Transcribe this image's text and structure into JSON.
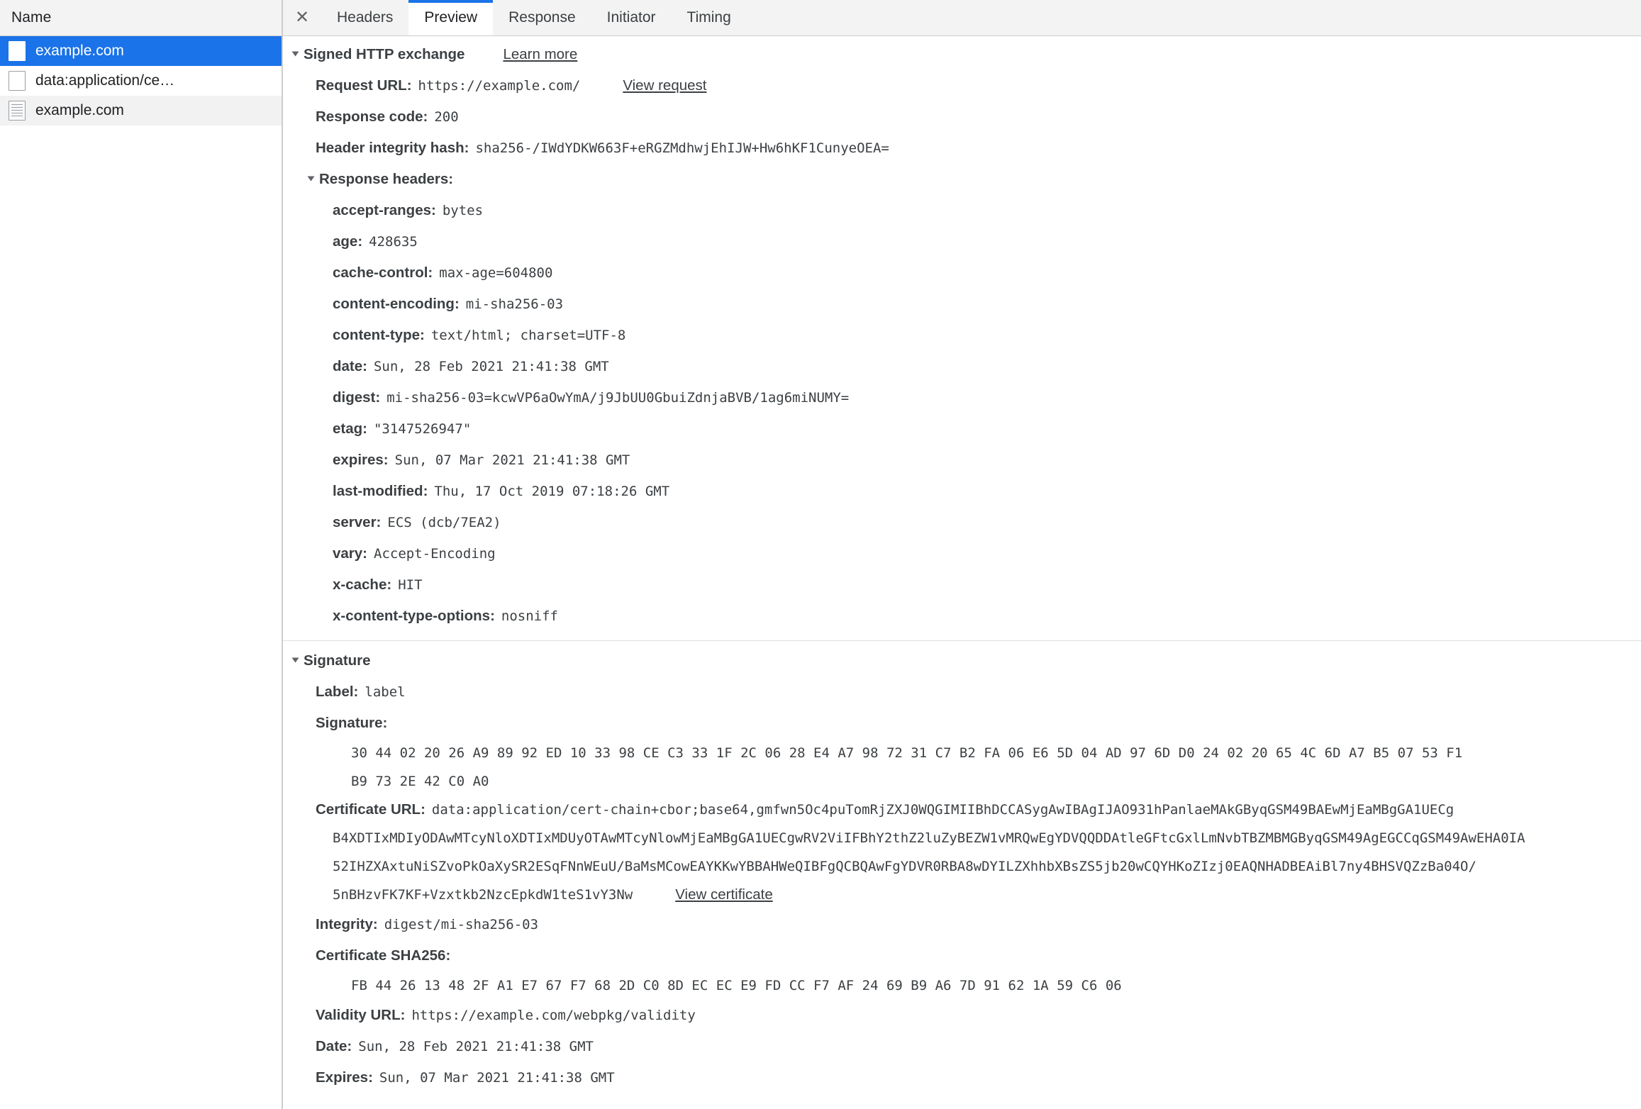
{
  "sidebar": {
    "header": "Name",
    "rows": [
      {
        "label": "example.com",
        "icon": "page-icon",
        "selected": true
      },
      {
        "label": "data:application/ce…",
        "icon": "page-icon",
        "selected": false
      },
      {
        "label": "example.com",
        "icon": "document-icon",
        "selected": false
      }
    ]
  },
  "tabbar": {
    "close_icon": "✕",
    "tabs": [
      {
        "label": "Headers",
        "active": false
      },
      {
        "label": "Preview",
        "active": true
      },
      {
        "label": "Response",
        "active": false
      },
      {
        "label": "Initiator",
        "active": false
      },
      {
        "label": "Timing",
        "active": false
      }
    ]
  },
  "sxg": {
    "title": "Signed HTTP exchange",
    "learn_more": "Learn more",
    "request_url_label": "Request URL:",
    "request_url_value": "https://example.com/",
    "view_request": "View request",
    "response_code_label": "Response code:",
    "response_code_value": "200",
    "header_integrity_label": "Header integrity hash:",
    "header_integrity_value": "sha256-/IWdYDKW663F+eRGZMdhwjEhIJW+Hw6hKF1CunyeOEA=",
    "response_headers_label": "Response headers:",
    "headers": [
      {
        "name": "accept-ranges:",
        "value": "bytes"
      },
      {
        "name": "age:",
        "value": "428635"
      },
      {
        "name": "cache-control:",
        "value": "max-age=604800"
      },
      {
        "name": "content-encoding:",
        "value": "mi-sha256-03"
      },
      {
        "name": "content-type:",
        "value": "text/html; charset=UTF-8"
      },
      {
        "name": "date:",
        "value": "Sun, 28 Feb 2021 21:41:38 GMT"
      },
      {
        "name": "digest:",
        "value": "mi-sha256-03=kcwVP6aOwYmA/j9JbUU0GbuiZdnjaBVB/1ag6miNUMY="
      },
      {
        "name": "etag:",
        "value": "\"3147526947\""
      },
      {
        "name": "expires:",
        "value": "Sun, 07 Mar 2021 21:41:38 GMT"
      },
      {
        "name": "last-modified:",
        "value": "Thu, 17 Oct 2019 07:18:26 GMT"
      },
      {
        "name": "server:",
        "value": "ECS (dcb/7EA2)"
      },
      {
        "name": "vary:",
        "value": "Accept-Encoding"
      },
      {
        "name": "x-cache:",
        "value": "HIT"
      },
      {
        "name": "x-content-type-options:",
        "value": "nosniff"
      }
    ]
  },
  "signature": {
    "title": "Signature",
    "label_label": "Label:",
    "label_value": "label",
    "signature_label": "Signature:",
    "signature_hex_lines": [
      "30 44 02 20 26 A9 89 92 ED 10 33 98 CE C3 33 1F 2C 06 28 E4 A7 98 72 31 C7 B2 FA 06 E6 5D 04 AD 97 6D D0 24 02 20 65 4C 6D A7 B5 07 53 F1",
      "B9 73 2E 42 C0 A0"
    ],
    "certificate_url_label": "Certificate URL:",
    "certificate_url_lines": [
      "data:application/cert-chain+cbor;base64,gmfwn5Oc4puTomRjZXJ0WQGIMIIBhDCCASygAwIBAgIJAO931hPanlaeMAkGByqGSM49BAEwMjEaMBgGA1UECg",
      "B4XDTIxMDIyODAwMTcyNloXDTIxMDUyOTAwMTcyNlowMjEaMBgGA1UECgwRV2ViIFBhY2thZ2luZyBEZW1vMRQwEgYDVQQDDAtleGFtcGxlLmNvbTBZMBMGByqGSM49AgEGCCqGSM49AwEHA0IA",
      "52IHZXAxtuNiSZvoPkOaXySR2ESqFNnWEuU/BaMsMCowEAYKKwYBBAHWeQIBFgQCBQAwFgYDVR0RBA8wDYILZXhhbXBsZS5jb20wCQYHKoZIzj0EAQNHADBEAiBl7ny4BHSVQZzBa04O/",
      "5nBHzvFK7KF+Vzxtkb2NzcEpkdW1teS1vY3Nw"
    ],
    "view_certificate": "View certificate",
    "integrity_label": "Integrity:",
    "integrity_value": "digest/mi-sha256-03",
    "certificate_sha256_label": "Certificate SHA256:",
    "certificate_sha256_hex": "FB 44 26 13 48 2F A1 E7 67 F7 68 2D C0 8D EC EC E9 FD CC F7 AF 24 69 B9 A6 7D 91 62 1A 59 C6 06",
    "validity_url_label": "Validity URL:",
    "validity_url_value": "https://example.com/webpkg/validity",
    "date_label": "Date:",
    "date_value": "Sun, 28 Feb 2021 21:41:38 GMT",
    "expires_label": "Expires:",
    "expires_value": "Sun, 07 Mar 2021 21:41:38 GMT"
  }
}
